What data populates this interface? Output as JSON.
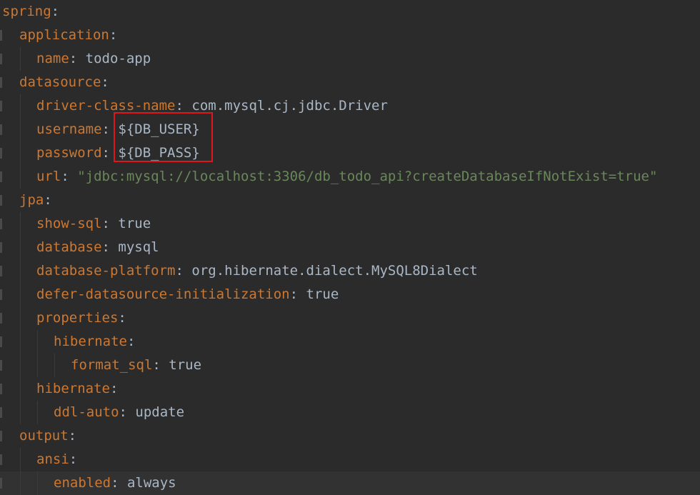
{
  "yaml_lines": [
    {
      "indent": 0,
      "key": "spring",
      "value": ""
    },
    {
      "indent": 1,
      "key": "application",
      "value": ""
    },
    {
      "indent": 2,
      "key": "name",
      "value": "todo-app"
    },
    {
      "indent": 1,
      "key": "datasource",
      "value": ""
    },
    {
      "indent": 2,
      "key": "driver-class-name",
      "value": "com.mysql.cj.jdbc.Driver"
    },
    {
      "indent": 2,
      "key": "username",
      "value": "${DB_USER}"
    },
    {
      "indent": 2,
      "key": "password",
      "value": "${DB_PASS}"
    },
    {
      "indent": 2,
      "key": "url",
      "value": "\"jdbc:mysql://localhost:3306/db_todo_api?createDatabaseIfNotExist=true\"",
      "string": true
    },
    {
      "indent": 1,
      "key": "jpa",
      "value": ""
    },
    {
      "indent": 2,
      "key": "show-sql",
      "value": "true"
    },
    {
      "indent": 2,
      "key": "database",
      "value": "mysql"
    },
    {
      "indent": 2,
      "key": "database-platform",
      "value": "org.hibernate.dialect.MySQL8Dialect"
    },
    {
      "indent": 2,
      "key": "defer-datasource-initialization",
      "value": "true"
    },
    {
      "indent": 2,
      "key": "properties",
      "value": ""
    },
    {
      "indent": 3,
      "key": "hibernate",
      "value": ""
    },
    {
      "indent": 4,
      "key": "format_sql",
      "value": "true"
    },
    {
      "indent": 2,
      "key": "hibernate",
      "value": ""
    },
    {
      "indent": 3,
      "key": "ddl-auto",
      "value": "update"
    },
    {
      "indent": 1,
      "key": "output",
      "value": ""
    },
    {
      "indent": 2,
      "key": "ansi",
      "value": ""
    },
    {
      "indent": 3,
      "key": "enabled",
      "value": "always"
    }
  ],
  "current_line": 20,
  "highlighted_lines": [
    5,
    6
  ],
  "colors": {
    "background": "#2b2b2b",
    "key": "#cc7832",
    "value": "#a9b7c6",
    "string": "#6a8759",
    "highlight_box": "#e0161a"
  }
}
